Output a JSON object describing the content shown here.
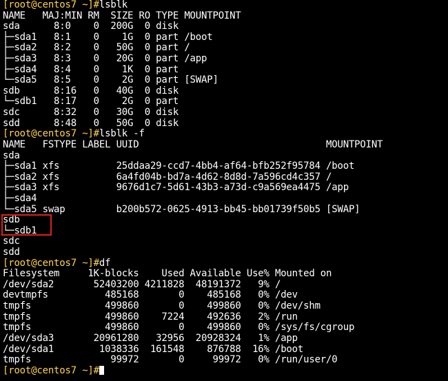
{
  "colors": {
    "background": "#000000",
    "text": "#ffffff",
    "prompt": "#ffd34a",
    "highlight_box": "#e02020"
  },
  "terminal": {
    "lines": [
      {
        "prompt": "[root@centos7 ~]#",
        "text": "lsblk"
      },
      {
        "prompt": "",
        "text": "NAME   MAJ:MIN RM  SIZE RO TYPE MOUNTPOINT"
      },
      {
        "prompt": "",
        "text": "sda      8:0    0  200G  0 disk"
      },
      {
        "prompt": "",
        "text": "├─sda1   8:1    0    1G  0 part /boot"
      },
      {
        "prompt": "",
        "text": "├─sda2   8:2    0   50G  0 part /"
      },
      {
        "prompt": "",
        "text": "├─sda3   8:3    0   20G  0 part /app"
      },
      {
        "prompt": "",
        "text": "├─sda4   8:4    0    1K  0 part"
      },
      {
        "prompt": "",
        "text": "└─sda5   8:5    0    2G  0 part [SWAP]"
      },
      {
        "prompt": "",
        "text": "sdb      8:16   0   40G  0 disk"
      },
      {
        "prompt": "",
        "text": "└─sdb1   8:17   0    2G  0 part"
      },
      {
        "prompt": "",
        "text": "sdc      8:32   0   30G  0 disk"
      },
      {
        "prompt": "",
        "text": "sdd      8:48   0   50G  0 disk"
      },
      {
        "prompt": "[root@centos7 ~]#",
        "text": "lsblk -f"
      },
      {
        "prompt": "",
        "text": "NAME   FSTYPE LABEL UUID                                 MOUNTPOINT"
      },
      {
        "prompt": "",
        "text": "sda"
      },
      {
        "prompt": "",
        "text": "├─sda1 xfs          25ddaa29-ccd7-4bb4-af64-bfb252f95784 /boot"
      },
      {
        "prompt": "",
        "text": "├─sda2 xfs          6a4fd04b-bd7a-4d62-8d8d-7a596cd4c357 /"
      },
      {
        "prompt": "",
        "text": "├─sda3 xfs          9676d1c7-5d61-43b3-a73d-c9a569ea4475 /app"
      },
      {
        "prompt": "",
        "text": "├─sda4"
      },
      {
        "prompt": "",
        "text": "└─sda5 swap         b200b572-0625-4913-bb45-bb01739f50b5 [SWAP]"
      },
      {
        "prompt": "",
        "text": "sdb"
      },
      {
        "prompt": "",
        "text": "└─sdb1"
      },
      {
        "prompt": "",
        "text": "sdc"
      },
      {
        "prompt": "",
        "text": "sdd"
      },
      {
        "prompt": "[root@centos7 ~]#",
        "text": "df"
      },
      {
        "prompt": "",
        "text": "Filesystem     1K-blocks    Used Available Use% Mounted on"
      },
      {
        "prompt": "",
        "text": "/dev/sda2       52403200 4211828  48191372   9% /"
      },
      {
        "prompt": "",
        "text": "devtmpfs          485168       0    485168   0% /dev"
      },
      {
        "prompt": "",
        "text": "tmpfs             499860       0    499860   0% /dev/shm"
      },
      {
        "prompt": "",
        "text": "tmpfs             499860    7224    492636   2% /run"
      },
      {
        "prompt": "",
        "text": "tmpfs             499860       0    499860   0% /sys/fs/cgroup"
      },
      {
        "prompt": "",
        "text": "/dev/sda3       20961280   32956  20928324   1% /app"
      },
      {
        "prompt": "",
        "text": "/dev/sda1        1038336  161548    876788  16% /boot"
      },
      {
        "prompt": "",
        "text": "tmpfs              99972       0     99972   0% /run/user/0"
      },
      {
        "prompt": "[root@centos7 ~]#",
        "text": ""
      }
    ]
  }
}
